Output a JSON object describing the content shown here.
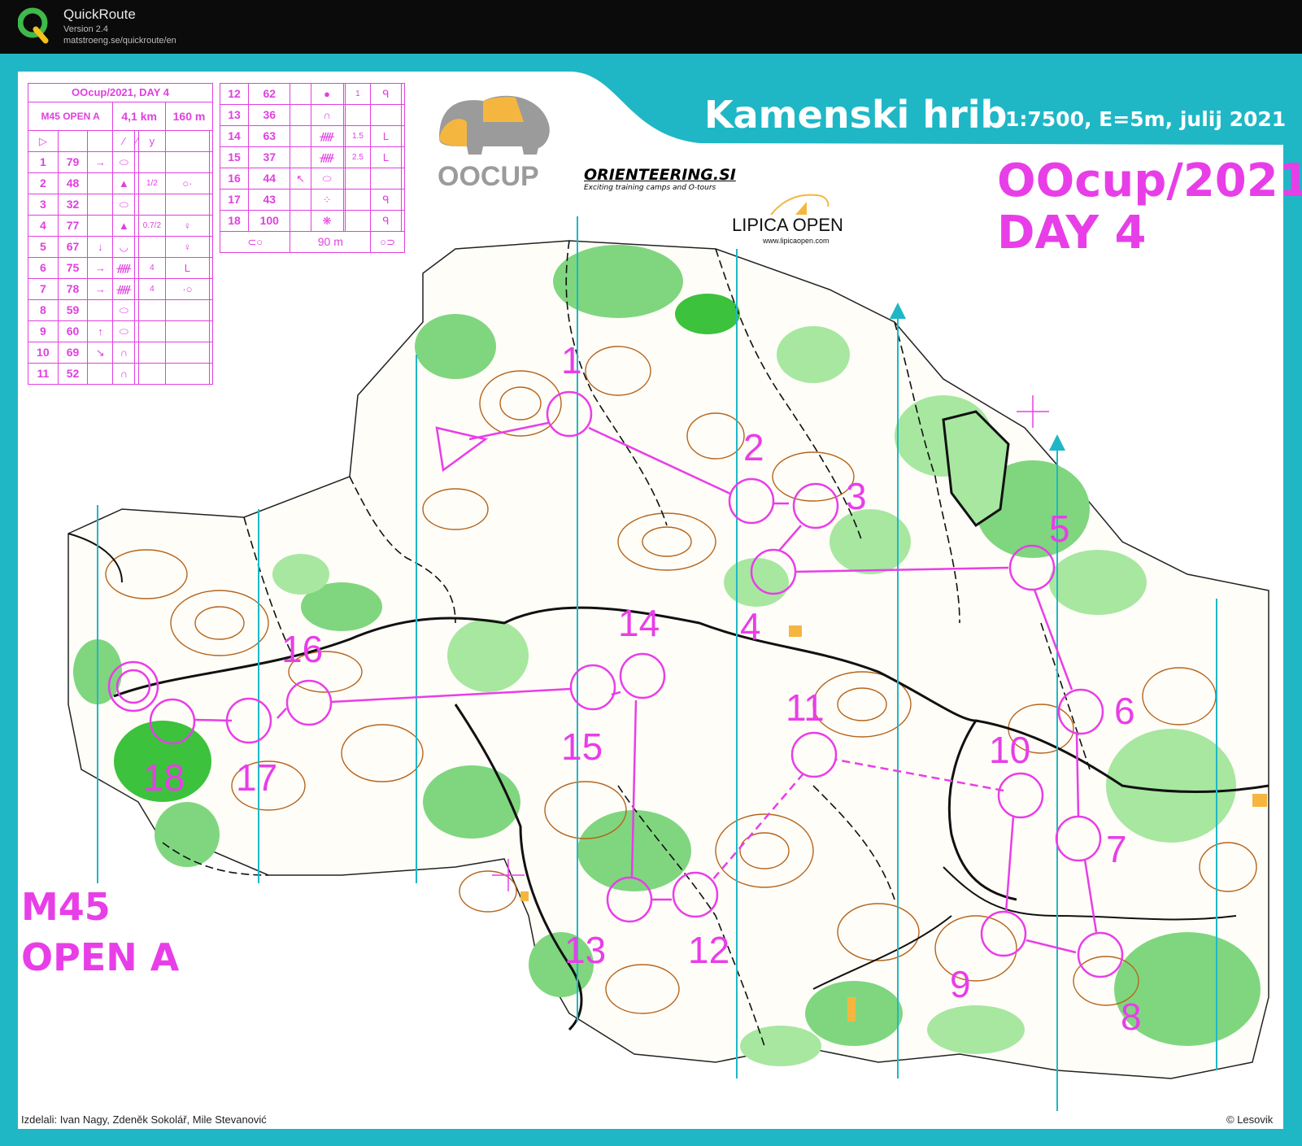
{
  "app": {
    "name": "QuickRoute",
    "version": "Version 2.4",
    "url": "matstroeng.se/quickroute/en"
  },
  "map": {
    "title": "Kamenski hrib",
    "scale_info": "1:7500, E=5m, julij 2021",
    "event_line1": "OOcup/2021",
    "event_line2": "DAY 4",
    "class_line1": "M45",
    "class_line2": "OPEN A",
    "mappers": "Izdelali: Ivan Nagy, Zdeněk Sokolář, Mile Stevanović",
    "copyright": "© Lesovik"
  },
  "sponsors": {
    "oocup_logo_text": "OOCUP",
    "orienteering_name": "ORIENTEERING.SI",
    "orienteering_tagline": "Exciting training camps and O-tours",
    "lipica_name": "LIPICA OPEN",
    "lipica_url": "www.lipicaopen.com"
  },
  "description_sheet": {
    "header": "OOcup/2021, DAY 4",
    "class": "M45 OPEN A",
    "length": "4,1 km",
    "climb": "160 m",
    "finish_distance": "90 m",
    "controls": [
      {
        "no": "1",
        "code": "79",
        "dir": "→",
        "feature": "⬭",
        "dim": "",
        "detail": ""
      },
      {
        "no": "2",
        "code": "48",
        "dir": "",
        "feature": "▲",
        "dim": "1/2",
        "detail": "○·"
      },
      {
        "no": "3",
        "code": "32",
        "dir": "",
        "feature": "⬭",
        "dim": "",
        "detail": ""
      },
      {
        "no": "4",
        "code": "77",
        "dir": "",
        "feature": "▲",
        "dim": "0.7/2",
        "detail": "♀"
      },
      {
        "no": "5",
        "code": "67",
        "dir": "↓",
        "feature": "◡",
        "dim": "",
        "detail": "♀"
      },
      {
        "no": "6",
        "code": "75",
        "dir": "→",
        "feature": "ᚏ",
        "dim": "4",
        "detail": "L"
      },
      {
        "no": "7",
        "code": "78",
        "dir": "→",
        "feature": "ᚏ",
        "dim": "4",
        "detail": "·○"
      },
      {
        "no": "8",
        "code": "59",
        "dir": "",
        "feature": "⬭",
        "dim": "",
        "detail": ""
      },
      {
        "no": "9",
        "code": "60",
        "dir": "↑",
        "feature": "⬭",
        "dim": "",
        "detail": ""
      },
      {
        "no": "10",
        "code": "69",
        "dir": "↘",
        "feature": "∩",
        "dim": "",
        "detail": ""
      },
      {
        "no": "11",
        "code": "52",
        "dir": "",
        "feature": "∩",
        "dim": "",
        "detail": ""
      },
      {
        "no": "12",
        "code": "62",
        "dir": "",
        "feature": "●",
        "dim": "1",
        "detail": "ᑫ"
      },
      {
        "no": "13",
        "code": "36",
        "dir": "",
        "feature": "∩",
        "dim": "",
        "detail": ""
      },
      {
        "no": "14",
        "code": "63",
        "dir": "",
        "feature": "ᚏ",
        "dim": "1.5",
        "detail": "L"
      },
      {
        "no": "15",
        "code": "37",
        "dir": "",
        "feature": "ᚏ",
        "dim": "2.5",
        "detail": "L"
      },
      {
        "no": "16",
        "code": "44",
        "dir": "↖",
        "feature": "⬭",
        "dim": "",
        "detail": ""
      },
      {
        "no": "17",
        "code": "43",
        "dir": "",
        "feature": "⁘",
        "dim": "",
        "detail": "ᑫ"
      },
      {
        "no": "18",
        "code": "100",
        "dir": "",
        "feature": "❋",
        "dim": "",
        "detail": "ᑫ"
      }
    ]
  },
  "course": {
    "control_labels": [
      "1",
      "2",
      "3",
      "4",
      "5",
      "6",
      "7",
      "8",
      "9",
      "10",
      "11",
      "12",
      "13",
      "14",
      "15",
      "16",
      "17",
      "18"
    ],
    "course_color": "#e83ee8",
    "north_line_color": "#1fb7c6"
  },
  "colors": {
    "frame": "#1fb7c6",
    "forest_green": "#6fd36f",
    "dark_green": "#3cc23c",
    "light_green": "#b8ecb0",
    "contour_brown": "#b5651d",
    "open_yellow": "#f5b640",
    "course_magenta": "#e83ee8"
  }
}
